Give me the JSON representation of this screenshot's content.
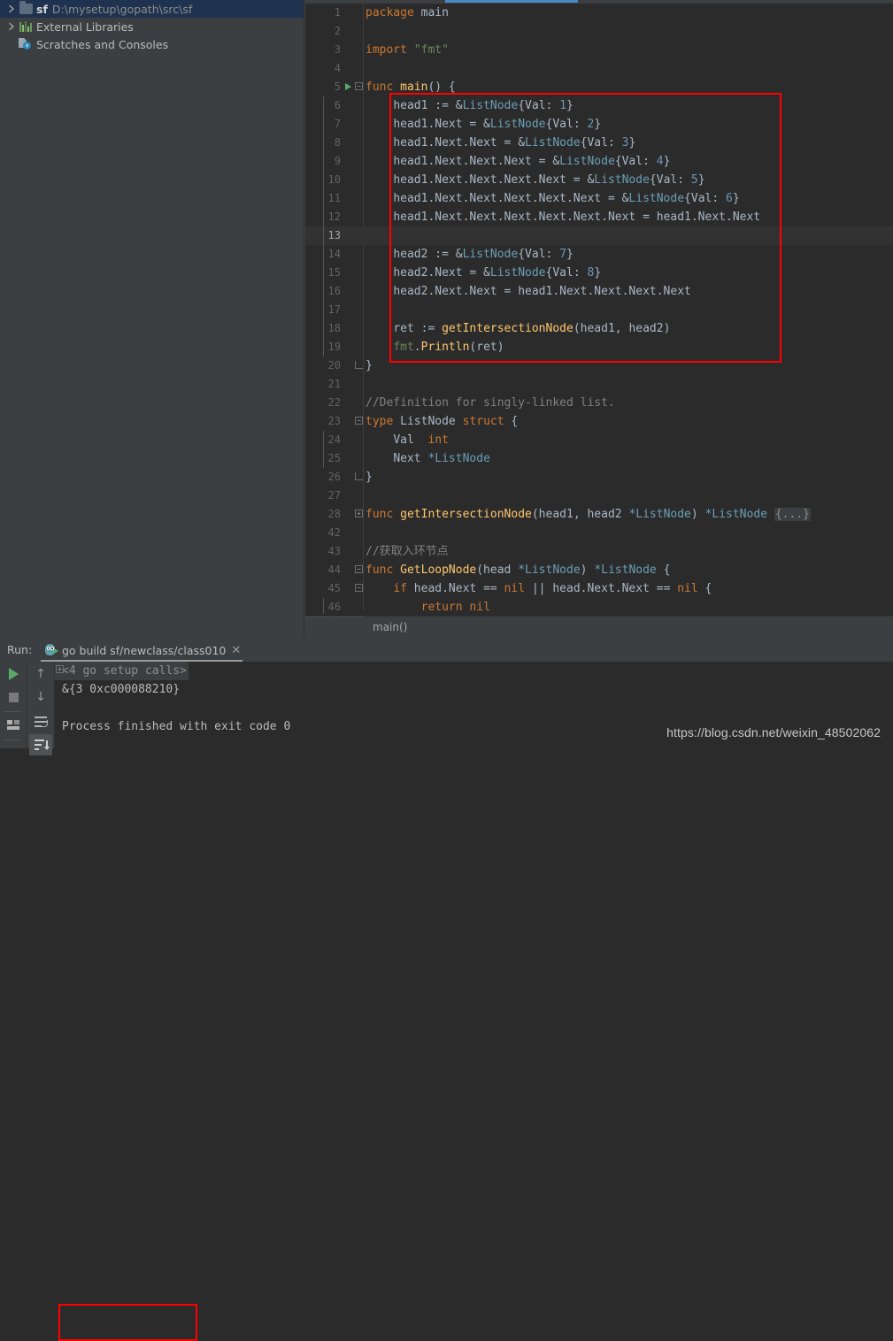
{
  "sidebar": {
    "items": [
      {
        "label": "sf",
        "path": "D:\\mysetup\\gopath\\src\\sf",
        "icon": "folder-icon",
        "selected": true,
        "expandable": true
      },
      {
        "label": "External Libraries",
        "path": "",
        "icon": "libraries-icon",
        "selected": false,
        "expandable": true
      },
      {
        "label": "Scratches and Consoles",
        "path": "",
        "icon": "scratches-icon",
        "selected": false,
        "expandable": false
      }
    ]
  },
  "editor": {
    "breadcrumb": "main()",
    "lines": [
      {
        "n": "1",
        "text": "package main"
      },
      {
        "n": "2",
        "text": ""
      },
      {
        "n": "3",
        "text": "import \"fmt\""
      },
      {
        "n": "4",
        "text": ""
      },
      {
        "n": "5",
        "text": "func main() {"
      },
      {
        "n": "6",
        "text": "    head1 := &ListNode{Val: 1}"
      },
      {
        "n": "7",
        "text": "    head1.Next = &ListNode{Val: 2}"
      },
      {
        "n": "8",
        "text": "    head1.Next.Next = &ListNode{Val: 3}"
      },
      {
        "n": "9",
        "text": "    head1.Next.Next.Next = &ListNode{Val: 4}"
      },
      {
        "n": "10",
        "text": "    head1.Next.Next.Next.Next = &ListNode{Val: 5}"
      },
      {
        "n": "11",
        "text": "    head1.Next.Next.Next.Next.Next = &ListNode{Val: 6}"
      },
      {
        "n": "12",
        "text": "    head1.Next.Next.Next.Next.Next.Next = head1.Next.Next"
      },
      {
        "n": "13",
        "text": ""
      },
      {
        "n": "14",
        "text": "    head2 := &ListNode{Val: 7}"
      },
      {
        "n": "15",
        "text": "    head2.Next = &ListNode{Val: 8}"
      },
      {
        "n": "16",
        "text": "    head2.Next.Next = head1.Next.Next.Next.Next"
      },
      {
        "n": "17",
        "text": ""
      },
      {
        "n": "18",
        "text": "    ret := getIntersectionNode(head1, head2)"
      },
      {
        "n": "19",
        "text": "    fmt.Println(ret)"
      },
      {
        "n": "20",
        "text": "}"
      },
      {
        "n": "21",
        "text": ""
      },
      {
        "n": "22",
        "text": "//Definition for singly-linked list."
      },
      {
        "n": "23",
        "text": "type ListNode struct {"
      },
      {
        "n": "24",
        "text": "    Val  int"
      },
      {
        "n": "25",
        "text": "    Next *ListNode"
      },
      {
        "n": "26",
        "text": "}"
      },
      {
        "n": "27",
        "text": ""
      },
      {
        "n": "28",
        "text": "func getIntersectionNode(head1, head2 *ListNode) *ListNode {...}"
      },
      {
        "n": "42",
        "text": ""
      },
      {
        "n": "43",
        "text": "//获取入环节点"
      },
      {
        "n": "44",
        "text": "func GetLoopNode(head *ListNode) *ListNode {"
      },
      {
        "n": "45",
        "text": "    if head.Next == nil || head.Next.Next == nil {"
      },
      {
        "n": "46",
        "text": "        return nil"
      }
    ],
    "current_line": "13",
    "fold_placeholder": "{...}"
  },
  "run_panel": {
    "label": "Run:",
    "tab_title": "go build sf/newclass/class010",
    "console_lines": [
      "<4 go setup calls>",
      "&{3 0xc000088210}",
      "",
      "Process finished with exit code 0"
    ]
  },
  "watermark": "https://blog.csdn.net/weixin_48502062",
  "colors": {
    "accent_blue": "#4a88c7",
    "highlight_red": "#ff0000",
    "selection_blue": "#1f3350",
    "editor_bg": "#2b2b2b",
    "panel_bg": "#3c3f41",
    "run_green": "#59a869"
  }
}
